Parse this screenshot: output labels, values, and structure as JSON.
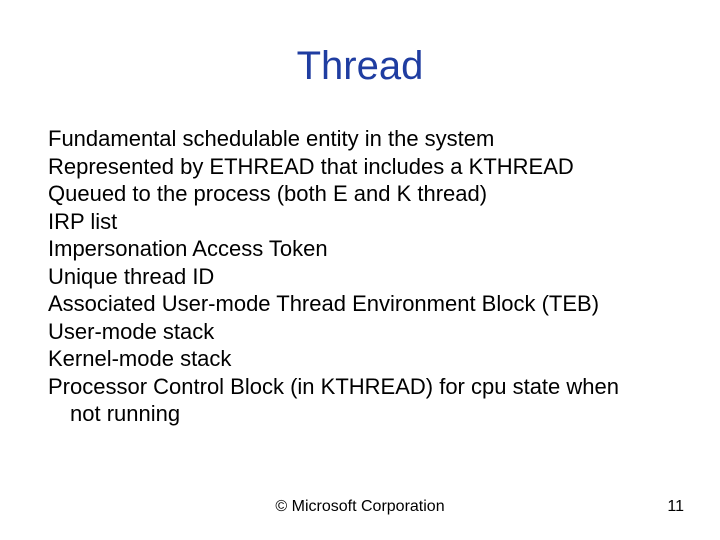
{
  "title": "Thread",
  "items": [
    "Fundamental schedulable entity in the system",
    "Represented by ETHREAD that includes a KTHREAD",
    "Queued to the process (both E and K thread)",
    "IRP list",
    "Impersonation Access Token",
    "Unique thread ID",
    "Associated User-mode Thread Environment Block (TEB)",
    "User-mode stack",
    "Kernel-mode stack",
    "Processor Control Block (in KTHREAD) for cpu state when",
    "not running"
  ],
  "footer": "© Microsoft Corporation",
  "page_number": "11"
}
